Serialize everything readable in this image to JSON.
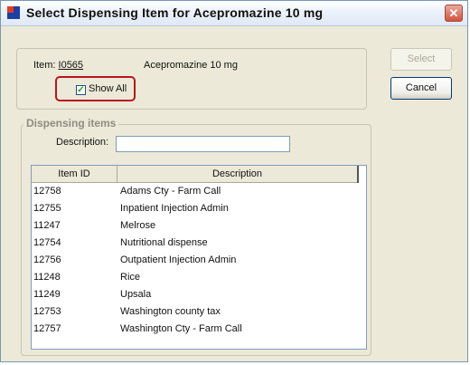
{
  "window": {
    "title": "Select Dispensing Item for Acepromazine 10 mg",
    "close_glyph": "✕"
  },
  "item": {
    "label": "Item:",
    "id": "I0565",
    "name": "Acepromazine 10 mg"
  },
  "show_all": {
    "label": "Show All",
    "checked": true,
    "check_glyph": "✓"
  },
  "buttons": {
    "select_label": "Select",
    "select_enabled": false,
    "cancel_label": "Cancel"
  },
  "dispensing": {
    "group_label": "Dispensing items",
    "description_label": "Description:",
    "description_value": "",
    "columns": [
      "Item ID",
      "Description"
    ],
    "rows": [
      {
        "id": "12758",
        "description": "Adams Cty - Farm Call"
      },
      {
        "id": "12755",
        "description": "Inpatient Injection Admin"
      },
      {
        "id": "11247",
        "description": "Melrose"
      },
      {
        "id": "12754",
        "description": "Nutritional dispense"
      },
      {
        "id": "12756",
        "description": "Outpatient Injection Admin"
      },
      {
        "id": "11248",
        "description": "Rice"
      },
      {
        "id": "11249",
        "description": "Upsala"
      },
      {
        "id": "12753",
        "description": "Washington county tax"
      },
      {
        "id": "12757",
        "description": "Washington Cty - Farm Call"
      }
    ]
  },
  "colors": {
    "highlight_border": "#b8161b",
    "check_color": "#1d9a1a",
    "close_button": "#d1553e"
  }
}
